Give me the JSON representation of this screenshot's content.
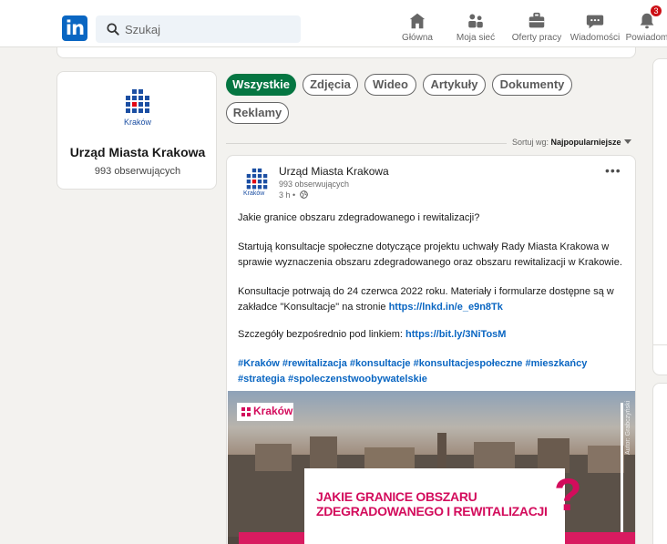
{
  "nav": {
    "logo": "in",
    "search_placeholder": "Szukaj",
    "items": [
      {
        "label": "Główna",
        "icon": "home-icon"
      },
      {
        "label": "Moja sieć",
        "icon": "network-icon"
      },
      {
        "label": "Oferty pracy",
        "icon": "briefcase-icon"
      },
      {
        "label": "Wiadomości",
        "icon": "messaging-icon"
      },
      {
        "label": "Powiadom",
        "icon": "bell-icon"
      }
    ],
    "notification_count": "3"
  },
  "company": {
    "logo_text": "Kraków",
    "name": "Urząd Miasta Krakowa",
    "followers": "993 obserwujących"
  },
  "filters": [
    "Wszystkie",
    "Zdjęcia",
    "Wideo",
    "Artykuły",
    "Dokumenty",
    "Reklamy"
  ],
  "active_filter": "Wszystkie",
  "sort": {
    "label": "Sortuj wg:",
    "value": "Najpopularniejsze"
  },
  "post": {
    "author": "Urząd Miasta Krakowa",
    "author_sub": "993 obserwujących",
    "time": "3 h •",
    "p1": "Jakie granice obszaru zdegradowanego i rewitalizacji?",
    "p2": "Startują konsultacje społeczne dotyczące projektu uchwały Rady Miasta Krakowa w sprawie wyznaczenia obszaru zdegradowanego oraz obszaru rewitalizacji w Krakowie.",
    "p3_text": "Konsultacje potrwają do 24 czerwca 2022 roku. Materiały i formularze dostępne są w zakładce \"Konsultacje\" na stronie ",
    "p3_link": "https://lnkd.in/e_e9n8Tk",
    "p4_text": "Szczegóły bezpośrednio pod linkiem: ",
    "p4_link": "https://bit.ly/3NiTosM",
    "hashtags": "#Kraków #rewitalizacja #konsultacje #konsultacjespołeczne #mieszkańcy #strategia #spoleczenstwoobywatelskie",
    "image": {
      "brand": "Kraków",
      "headline_line1": "JAKIE GRANICE OBSZARU",
      "headline_line2": "ZDEGRADOWANEGO I REWITALIZACJI",
      "qmark": "?",
      "credit": "Autor: Grabczyński"
    }
  },
  "colors": {
    "linkedin_blue": "#0a66c2",
    "active_pill": "#057642",
    "kraków_pink": "#d30c5c"
  }
}
